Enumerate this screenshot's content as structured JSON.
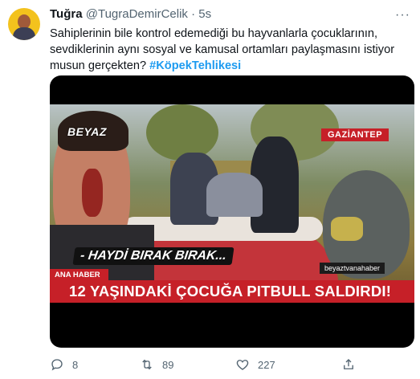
{
  "tweet": {
    "author": {
      "display_name": "Tuğra",
      "handle": "@TugraDemirCelik",
      "separator": "·",
      "time": "5s"
    },
    "text_main": "Sahiplerinin bile kontrol edemediği bu hayvanlarla çocuklarının, sevdiklerinin aynı sosyal ve kamusal ortamları paylaşmasını istiyor musun gerçekten?",
    "hashtag": "#KöpekTehlikesi",
    "more_label": "···"
  },
  "media": {
    "channel_logo": "BEYAZ",
    "location": "GAZİANTEP",
    "quote": "- HAYDİ BIRAK BIRAK...",
    "source_tag": "beyaztvanahaber",
    "show_name": "ANA HABER",
    "headline": "12 YAŞINDAKİ ÇOCUĞA PITBULL SALDIRDI!"
  },
  "actions": {
    "reply_count": "8",
    "retweet_count": "89",
    "like_count": "227",
    "icons": [
      "reply-icon",
      "retweet-icon",
      "like-icon",
      "share-icon"
    ]
  }
}
